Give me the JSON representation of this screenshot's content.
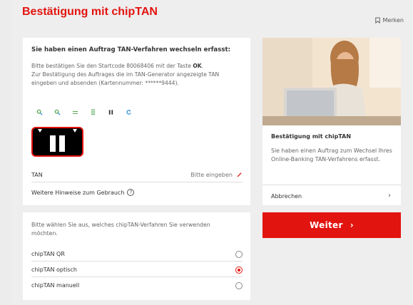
{
  "header": {
    "title": "Bestätigung mit chipTAN",
    "bookmark_label": "Merken"
  },
  "main": {
    "heading": "Sie haben einen Auftrag TAN-Verfahren wechseln erfasst:",
    "instruction_line1_pre": "Bitte bestätigen Sie den Startcode 80068406 mit der Taste ",
    "instruction_line1_key": "OK",
    "instruction_line1_post": ".",
    "instruction_line2": "Zur Bestätigung des Auftrages die im TAN-Generator angezeigte TAN eingeben und absenden (Kartennummer: ******9444).",
    "tools": [
      "zoom-in-icon",
      "zoom-out-icon",
      "speed-slower-icon",
      "speed-faster-icon",
      "pause-icon",
      "restart-icon"
    ],
    "tan_label": "TAN",
    "tan_placeholder": "Bitte eingeben",
    "hint_label": "Weitere Hinweise zum Gebrauch",
    "hint_icon": "?"
  },
  "side": {
    "title": "Bestätigung mit chipTAN",
    "text": "Sie haben einen Auftrag zum Wechsel Ihres Online-Banking TAN-Verfahrens erfasst.",
    "cancel_label": "Abbrechen",
    "cancel_chevron": "›"
  },
  "weiter": {
    "label": "Weiter",
    "chevron": "›"
  },
  "choice": {
    "prompt": "Bitte wählen Sie aus, welches chipTAN-Verfahren Sie verwenden möchten.",
    "options": [
      {
        "label": "chipTAN QR",
        "selected": false
      },
      {
        "label": "chipTAN optisch",
        "selected": true
      },
      {
        "label": "chipTAN manuell",
        "selected": false
      }
    ]
  },
  "colors": {
    "accent": "#e2140f",
    "background": "#eeeeee",
    "card": "#ffffff"
  }
}
